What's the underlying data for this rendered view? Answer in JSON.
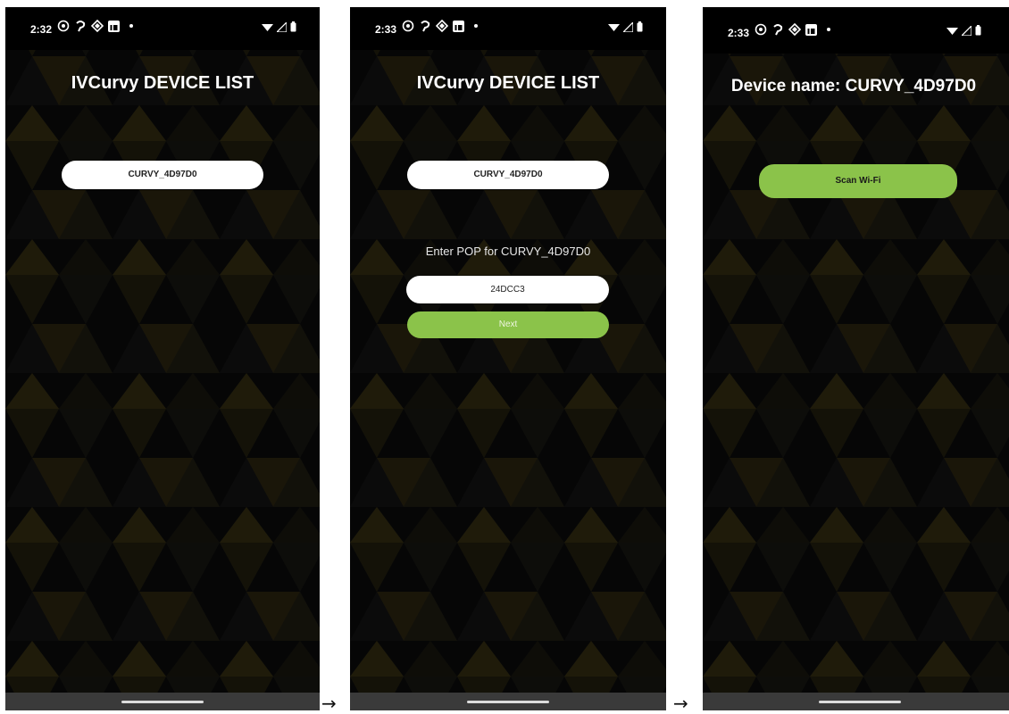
{
  "screens": [
    {
      "status_time": "2:32",
      "title": "IVCurvy DEVICE LIST",
      "device_button": "CURVY_4D97D0"
    },
    {
      "status_time": "2:33",
      "title": "IVCurvy DEVICE LIST",
      "device_button": "CURVY_4D97D0",
      "pop_prompt": "Enter POP for CURVY_4D97D0",
      "pop_value": "24DCC3",
      "next_label": "Next"
    },
    {
      "status_time": "2:33",
      "title": "Device name: CURVY_4D97D0",
      "scan_label": "Scan Wi-Fi"
    }
  ],
  "arrows": [
    "→",
    "→"
  ],
  "colors": {
    "accent_green": "#8bc34a",
    "background": "#050505",
    "button_white": "#ffffff"
  },
  "icons": [
    "whatsapp-icon",
    "brand-swirl-icon",
    "diamond-icon",
    "linkedin-icon",
    "wifi-icon",
    "signal-icon",
    "battery-icon"
  ]
}
